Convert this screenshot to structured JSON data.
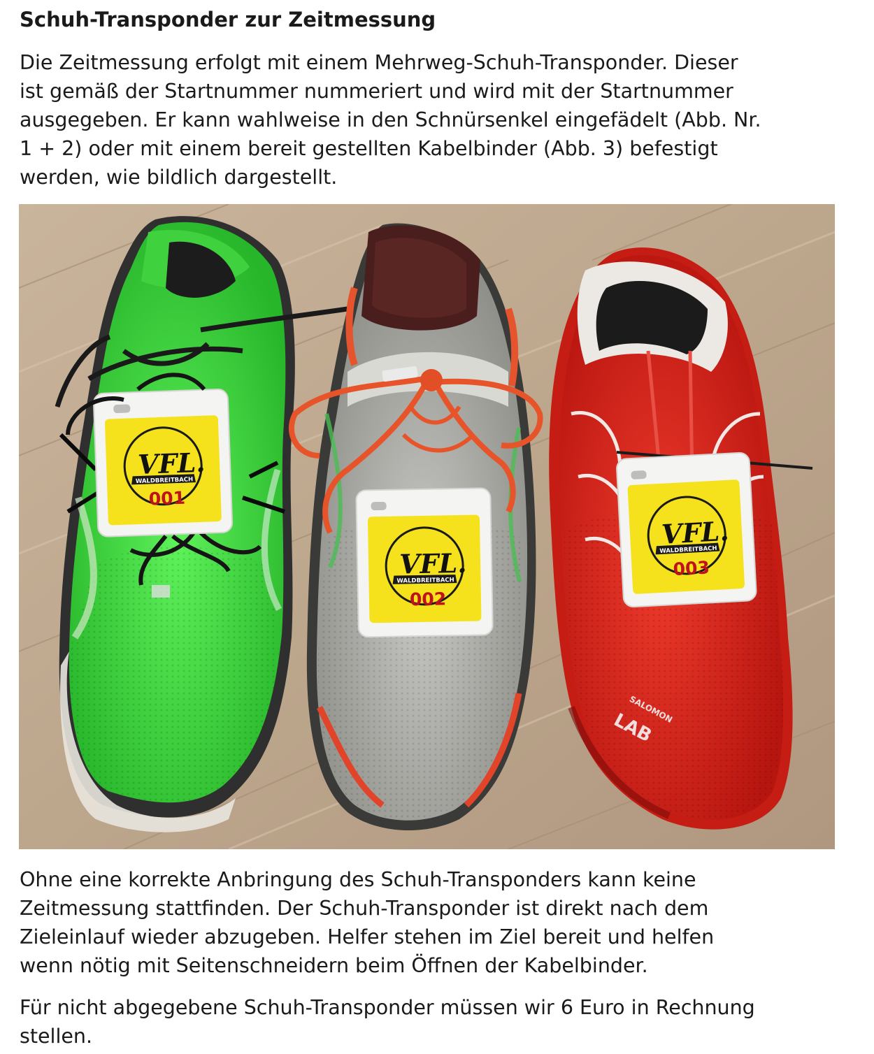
{
  "title": "Schuh-Transponder zur Zeitmessung",
  "intro_lines": [
    "Die Zeitmessung erfolgt mit einem Mehrweg-Schuh-Transponder. Dieser",
    "ist gemäß der Startnummer nummeriert und wird mit der Startnummer",
    "ausgegeben. Er kann wahlweise in den Schnürsenkel eingefädelt (Abb. Nr.",
    "1 + 2) oder mit einem bereit gestellten Kabelbinder (Abb. 3) befestigt",
    "werden, wie bildlich dargestellt."
  ],
  "photo": {
    "tags": [
      {
        "logo": "VFL.",
        "club": "WALDBREITBACH",
        "number": "001"
      },
      {
        "logo": "VFL.",
        "club": "WALDBREITBACH",
        "number": "002"
      },
      {
        "logo": "VFL.",
        "club": "WALDBREITBACH",
        "number": "003"
      }
    ],
    "brand_top": "SALOMON",
    "brand_bottom": "LAB"
  },
  "middle_lines": [
    "Ohne eine korrekte Anbringung des Schuh-Transponders kann keine",
    "Zeitmessung stattfinden. Der Schuh-Transponder ist direkt nach dem",
    "Zieleinlauf wieder abzugeben. Helfer stehen im Ziel bereit und helfen",
    "wenn nötig mit Seitenschneidern beim Öffnen der Kabelbinder."
  ],
  "closing_lines": [
    "Für nicht abgegebene Schuh-Transponder müssen wir 6 Euro in Rechnung",
    "stellen."
  ]
}
